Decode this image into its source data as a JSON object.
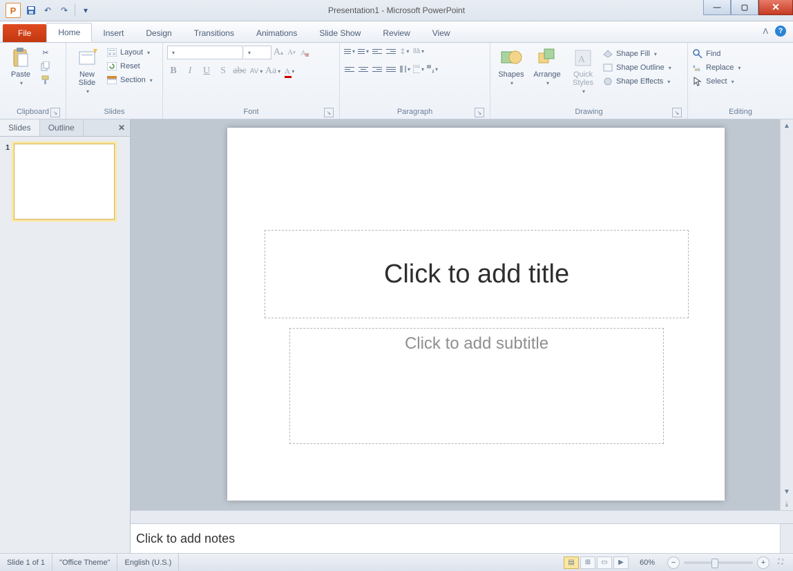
{
  "title": "Presentation1 - Microsoft PowerPoint",
  "tabs": {
    "file": "File",
    "home": "Home",
    "insert": "Insert",
    "design": "Design",
    "transitions": "Transitions",
    "animations": "Animations",
    "slideshow": "Slide Show",
    "review": "Review",
    "view": "View"
  },
  "groups": {
    "clipboard": "Clipboard",
    "slides": "Slides",
    "font": "Font",
    "paragraph": "Paragraph",
    "drawing": "Drawing",
    "editing": "Editing"
  },
  "clipboard": {
    "paste": "Paste"
  },
  "slides": {
    "new": "New\nSlide",
    "layout": "Layout",
    "reset": "Reset",
    "section": "Section"
  },
  "drawing": {
    "shapes": "Shapes",
    "arrange": "Arrange",
    "quick": "Quick\nStyles",
    "fill": "Shape Fill",
    "outline": "Shape Outline",
    "effects": "Shape Effects"
  },
  "editing": {
    "find": "Find",
    "replace": "Replace",
    "select": "Select"
  },
  "sidetabs": {
    "slides": "Slides",
    "outline": "Outline"
  },
  "thumb": {
    "num": "1"
  },
  "placeholders": {
    "title": "Click to add title",
    "sub": "Click to add subtitle"
  },
  "notes": "Click to add notes",
  "status": {
    "slide": "Slide 1 of 1",
    "theme": "\"Office Theme\"",
    "lang": "English (U.S.)",
    "zoom": "60%"
  }
}
